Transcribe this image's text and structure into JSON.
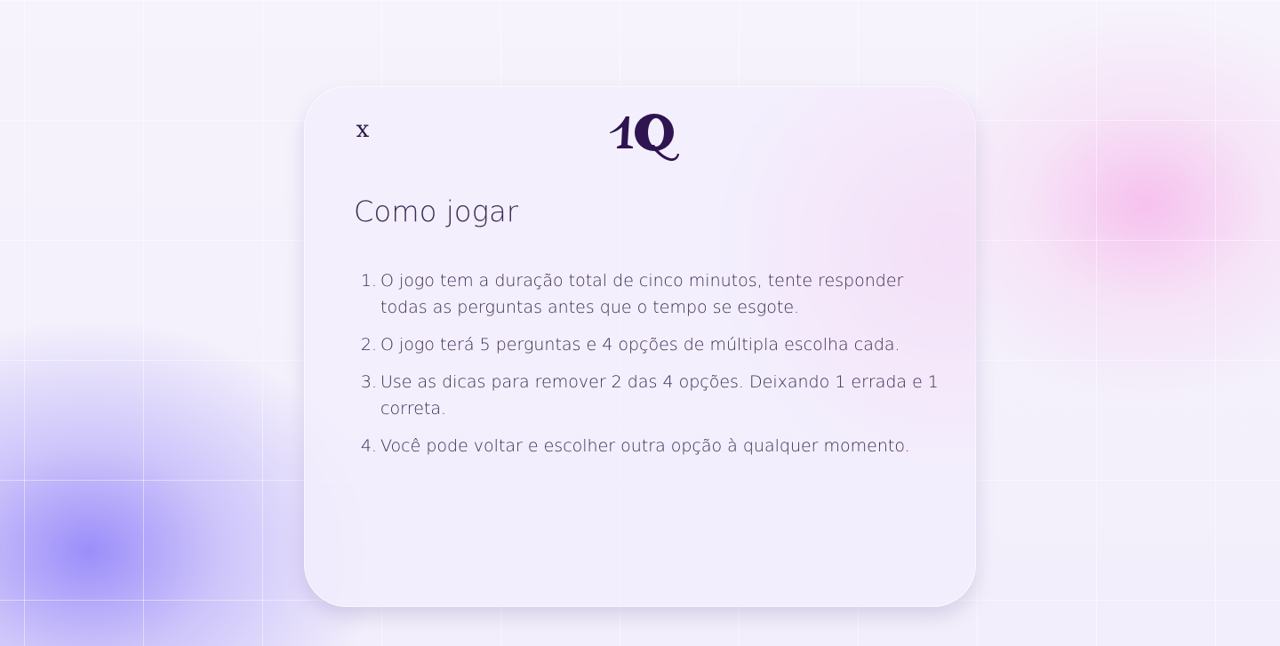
{
  "dialog": {
    "close_label": "x",
    "logo_icon": "1q-logo-icon",
    "title": "Como jogar",
    "rules": [
      {
        "number": "1.",
        "text": "O jogo tem a duração total de cinco minutos, tente responder todas as perguntas antes que o tempo se esgote."
      },
      {
        "number": "2.",
        "text": "O jogo terá 5 perguntas e 4 opções de múltipla escolha cada."
      },
      {
        "number": "3.",
        "text": "Use as dicas para remover 2 das 4 opções. Deixando 1 errada e 1 correta."
      },
      {
        "number": "4.",
        "text": "Você pode voltar e escolher outra opção à qualquer momento."
      }
    ]
  },
  "colors": {
    "brand": "#2e1450",
    "text": "#3b2a52",
    "card": "#f3eefc",
    "accent_violet": "#8c7dfa",
    "accent_pink": "#f6b9ec"
  }
}
